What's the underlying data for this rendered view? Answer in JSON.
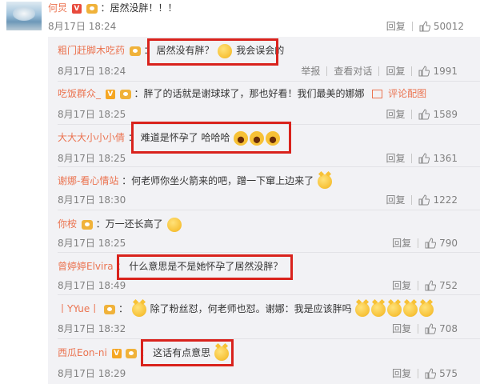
{
  "top": {
    "username": "何炅",
    "text": "：居然没胖！！！",
    "time": "8月17日 18:24",
    "reply": "回复",
    "likes": "50012"
  },
  "comments": [
    {
      "username": "粗门赶脚木吃药",
      "text": "居然没有胖？",
      "text2": "我会误会的",
      "time": "8月17日 18:24",
      "actions": [
        "举报",
        "查看对话",
        "回复"
      ],
      "likes": "1991"
    },
    {
      "username": "吃饭群众_",
      "text": "：胖了的话就是谢球球了，那也好看！我们最美的娜娜",
      "extra": "评论配图",
      "time": "8月17日 18:25",
      "actions": [
        "回复"
      ],
      "likes": "1589"
    },
    {
      "username": "大大大小小小倩",
      "text": "难道是怀孕了 哈哈哈",
      "time": "8月17日 18:25",
      "actions": [
        "回复"
      ],
      "likes": "1361"
    },
    {
      "username": "谢娜-看心情站",
      "text": "：何老师你坐火箭来的吧，蹭一下窜上边来了",
      "time": "8月17日 18:30",
      "actions": [
        "回复"
      ],
      "likes": "1222"
    },
    {
      "username": "你桉",
      "text": "：万一还长高了",
      "time": "8月17日 18:25",
      "actions": [
        "回复"
      ],
      "likes": "790"
    },
    {
      "username": "曾婷婷Elvira",
      "text": "什么意思是不是她怀孕了居然没胖？",
      "time": "8月17日 18:49",
      "actions": [
        "回复"
      ],
      "likes": "752"
    },
    {
      "username": "丨YYue丨",
      "text": "除了粉丝怼，何老师也怼。谢娜：我是应该胖吗",
      "time": "8月17日 18:32",
      "actions": [
        "回复"
      ],
      "likes": "708"
    },
    {
      "username": "西瓜Eon-ni",
      "text": "这话有点意思",
      "time": "8月17日 18:29",
      "actions": [
        "回复"
      ],
      "likes": "575"
    }
  ],
  "colors": {
    "username": "#eb7350",
    "highlight_box": "#d9221c",
    "panel_bg": "#f2f2f5"
  }
}
